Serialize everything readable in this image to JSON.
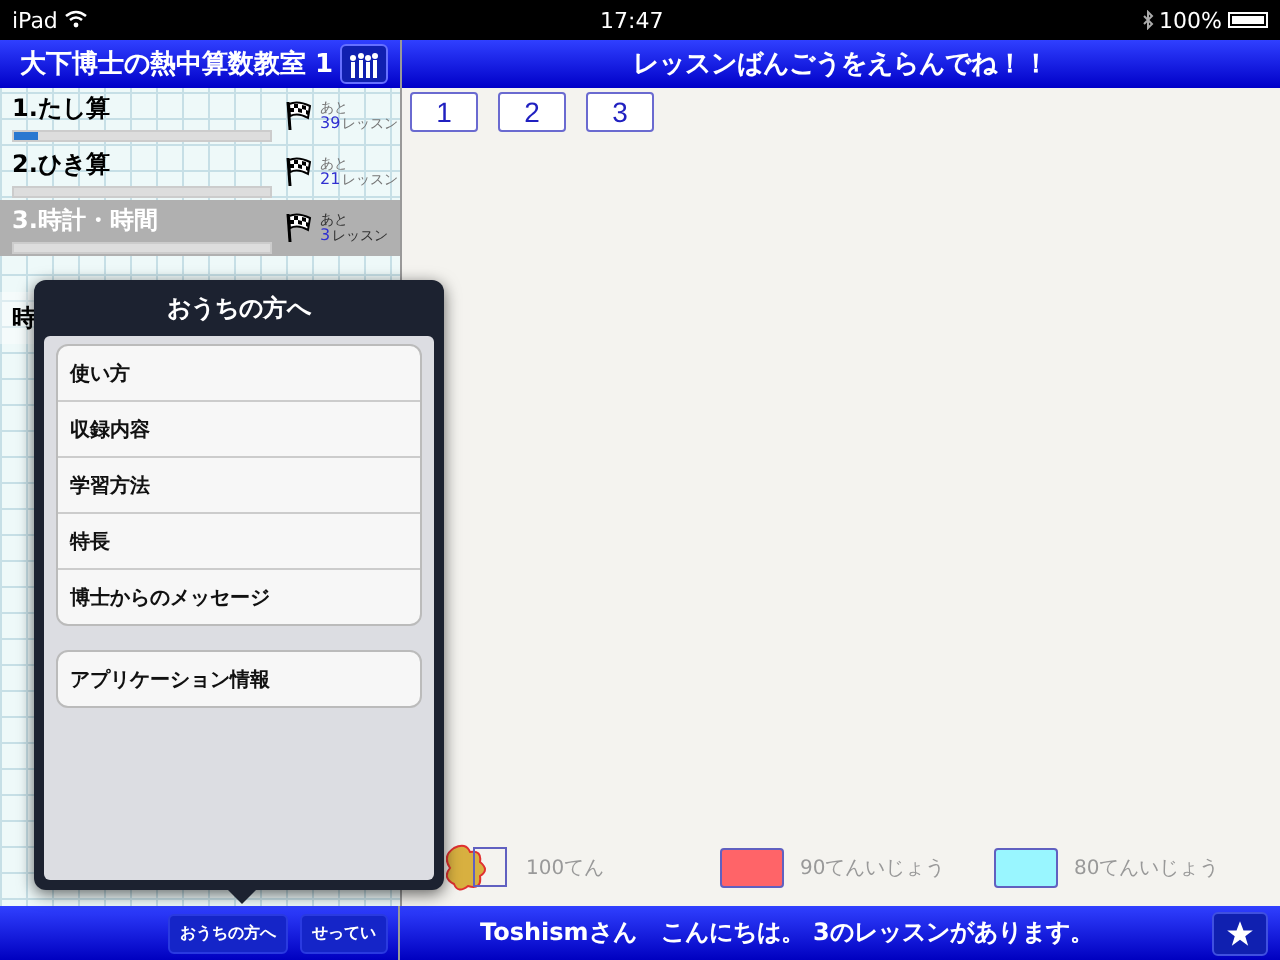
{
  "status_bar": {
    "device": "iPad",
    "time": "17:47",
    "battery": "100%"
  },
  "sidebar": {
    "title": "大下博士の熱中算数教室 1",
    "lessons": [
      {
        "title": "1.たし算",
        "level": 0.09,
        "remaining_label": "あと",
        "remaining": "39",
        "unit": "レッスン",
        "selected": false
      },
      {
        "title": "2.ひき算",
        "level": 0,
        "remaining_label": "あと",
        "remaining": "21",
        "unit": "レッスン",
        "selected": false
      },
      {
        "title": "3.時計・時間",
        "level": 0,
        "remaining_label": "あと",
        "remaining": "3",
        "unit": "レッスン",
        "selected": true
      }
    ],
    "section_title": "時"
  },
  "popover": {
    "title": "おうちの方へ",
    "groups": [
      [
        "使い方",
        "収録内容",
        "学習方法",
        "特長",
        "博士からのメッセージ"
      ],
      [
        "アプリケーション情報"
      ]
    ]
  },
  "bottom_left_buttons": [
    "おうちの方へ",
    "せってい"
  ],
  "main": {
    "title": "レッスンばんごうをえらんでね！！",
    "lesson_buttons": [
      "1",
      "2",
      "3"
    ],
    "legend": [
      {
        "kind": "medal",
        "label": "100てん"
      },
      {
        "kind": "swatch",
        "color": "#ff6468",
        "label": "90てんいじょう"
      },
      {
        "kind": "swatch",
        "color": "#99f6ff",
        "label": "80てんいじょう"
      }
    ],
    "message": "Toshismさん　こんにちは。 3のレッスンがあります。"
  }
}
